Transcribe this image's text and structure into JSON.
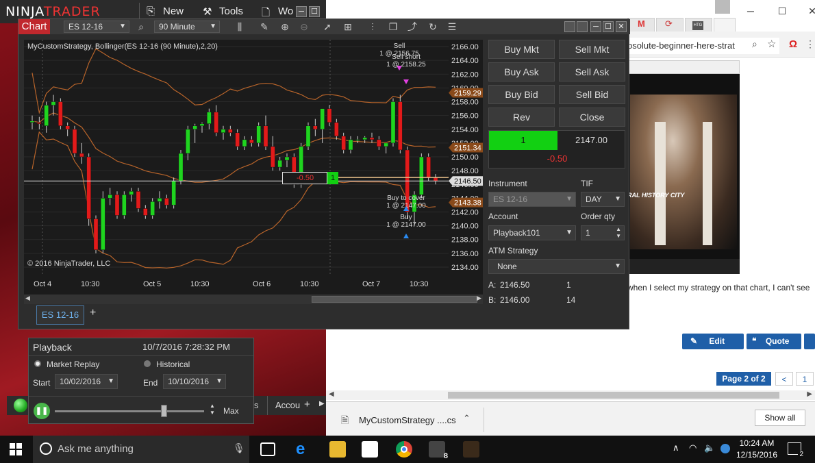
{
  "ninjatrader": {
    "logo_left": "NINJA",
    "logo_right": "TRADER",
    "menu": {
      "new": "New",
      "tools": "Tools",
      "workspaces": "Wo"
    }
  },
  "chart": {
    "tab_label": "Chart",
    "instrument": "ES 12-16",
    "interval": "90 Minute",
    "strategy_label": "MyCustomStrategy, Bollinger(ES 12-16 (90 Minute),2,20)",
    "copyright": "© 2016 NinjaTrader, LLC",
    "bottom_tab": "ES 12-16",
    "bottom_tab_add": "+",
    "position_line": {
      "pnl": "-0.50",
      "qty": "1"
    }
  },
  "chart_data": {
    "type": "candlestick",
    "title": "",
    "x_tick_labels": [
      "Oct 4",
      "10:30",
      "Oct 5",
      "10:30",
      "Oct 6",
      "10:30",
      "Oct 7",
      "10:30"
    ],
    "y_tick_labels": [
      "2166.00",
      "2164.00",
      "2162.00",
      "2160.00",
      "2158.00",
      "2156.00",
      "2154.00",
      "2152.00",
      "2150.00",
      "2148.00",
      "2146.00",
      "2144.00",
      "2142.00",
      "2140.00",
      "2138.00",
      "2136.00",
      "2134.00"
    ],
    "ylim": [
      2133,
      2167
    ],
    "price_markers": [
      {
        "value": "2159.29",
        "color": "#8a4a1a"
      },
      {
        "value": "2151.34",
        "color": "#8a4a1a"
      },
      {
        "value": "2146.50",
        "color": "#dddddd"
      },
      {
        "value": "2143.38",
        "color": "#8a4a1a"
      }
    ],
    "candles": [
      [
        2155.0,
        2156.0,
        2154.0,
        2155.2
      ],
      [
        2155.0,
        2155.8,
        2154.0,
        2154.8
      ],
      [
        2154.5,
        2158.0,
        2153.5,
        2157.5
      ],
      [
        2157.5,
        2159.0,
        2156.0,
        2158.0
      ],
      [
        2158.0,
        2158.5,
        2154.0,
        2154.5
      ],
      [
        2154.5,
        2155.0,
        2153.0,
        2154.0
      ],
      [
        2154.0,
        2154.5,
        2150.0,
        2150.5
      ],
      [
        2150.5,
        2152.0,
        2149.0,
        2150.0
      ],
      [
        2150.0,
        2150.5,
        2140.0,
        2141.0
      ],
      [
        2141.0,
        2141.5,
        2136.0,
        2136.5
      ],
      [
        2136.5,
        2145.0,
        2136.0,
        2144.0
      ],
      [
        2144.0,
        2145.5,
        2143.0,
        2144.5
      ],
      [
        2144.5,
        2145.0,
        2141.0,
        2141.5
      ],
      [
        2141.5,
        2145.0,
        2141.0,
        2144.5
      ],
      [
        2144.5,
        2145.5,
        2143.5,
        2145.0
      ],
      [
        2145.0,
        2145.5,
        2142.0,
        2142.5
      ],
      [
        2142.5,
        2143.0,
        2141.0,
        2141.5
      ],
      [
        2141.5,
        2144.0,
        2141.0,
        2143.5
      ],
      [
        2143.5,
        2145.0,
        2142.5,
        2144.0
      ],
      [
        2144.0,
        2144.5,
        2142.5,
        2143.0
      ],
      [
        2143.0,
        2147.0,
        2142.5,
        2146.5
      ],
      [
        2146.5,
        2151.0,
        2146.0,
        2150.5
      ],
      [
        2150.5,
        2154.5,
        2149.5,
        2154.0
      ],
      [
        2154.0,
        2154.8,
        2152.0,
        2154.5
      ],
      [
        2154.5,
        2155.0,
        2153.5,
        2154.8
      ],
      [
        2154.8,
        2157.0,
        2154.0,
        2156.5
      ],
      [
        2156.5,
        2157.5,
        2153.0,
        2153.5
      ],
      [
        2153.5,
        2154.5,
        2152.5,
        2154.0
      ],
      [
        2154.0,
        2154.5,
        2153.0,
        2153.5
      ],
      [
        2153.5,
        2154.0,
        2151.0,
        2151.5
      ],
      [
        2151.5,
        2153.0,
        2151.0,
        2152.5
      ],
      [
        2152.5,
        2153.0,
        2151.5,
        2152.0
      ],
      [
        2152.0,
        2155.0,
        2151.5,
        2154.5
      ],
      [
        2154.5,
        2156.0,
        2151.0,
        2151.5
      ],
      [
        2151.5,
        2153.0,
        2148.0,
        2148.5
      ],
      [
        2148.5,
        2150.0,
        2148.0,
        2149.5
      ],
      [
        2149.5,
        2150.5,
        2148.5,
        2150.0
      ],
      [
        2150.0,
        2150.5,
        2145.5,
        2146.0
      ],
      [
        2146.0,
        2152.0,
        2145.5,
        2151.5
      ],
      [
        2151.5,
        2155.0,
        2151.0,
        2154.5
      ],
      [
        2154.5,
        2155.5,
        2153.0,
        2154.0
      ],
      [
        2154.0,
        2155.0,
        2152.0,
        2157.0
      ],
      [
        2157.0,
        2157.5,
        2154.5,
        2155.0
      ],
      [
        2155.0,
        2155.5,
        2152.5,
        2153.0
      ],
      [
        2153.0,
        2153.5,
        2150.5,
        2151.0
      ],
      [
        2151.0,
        2153.0,
        2150.5,
        2152.5
      ],
      [
        2152.5,
        2153.0,
        2152.0,
        2152.5
      ],
      [
        2152.5,
        2153.0,
        2152.0,
        2152.8
      ],
      [
        2152.8,
        2153.5,
        2152.0,
        2152.5
      ],
      [
        2152.5,
        2153.0,
        2151.0,
        2151.5
      ],
      [
        2151.5,
        2152.0,
        2150.5,
        2152.0
      ],
      [
        2152.0,
        2158.5,
        2151.5,
        2158.0
      ],
      [
        2158.0,
        2159.0,
        2150.5,
        2151.0
      ],
      [
        2151.0,
        2151.5,
        2141.0,
        2142.0
      ],
      [
        2142.0,
        2145.0,
        2140.0,
        2144.5
      ],
      [
        2144.5,
        2150.5,
        2144.0,
        2150.0
      ],
      [
        2150.0,
        2150.5,
        2146.5,
        2147.0
      ],
      [
        2147.0,
        2147.5,
        2146.0,
        2146.5
      ]
    ],
    "markers": [
      {
        "label": "Sell",
        "sub": "1 @ 2156.75",
        "color": "#e040e0"
      },
      {
        "label": "Sell short",
        "sub": "1 @ 2158.25",
        "color": "#e040e0"
      },
      {
        "label": "Buy to cover",
        "sub": "1 @ 2147.00",
        "color": "#2a8af0"
      },
      {
        "label": "Buy",
        "sub": "1 @ 2147.00",
        "color": "#2a8af0"
      }
    ]
  },
  "trader": {
    "buttons": [
      "Buy Mkt",
      "Sell Mkt",
      "Buy Ask",
      "Sell Ask",
      "Buy Bid",
      "Sell Bid",
      "Rev",
      "Close"
    ],
    "position_qty": "1",
    "position_price": "2147.00",
    "position_pnl": "-0.50",
    "instrument_label": "Instrument",
    "instrument_value": "ES 12-16",
    "tif_label": "TIF",
    "tif_value": "DAY",
    "account_label": "Account",
    "account_value": "Playback101",
    "order_qty_label": "Order qty",
    "order_qty_value": "1",
    "atm_label": "ATM Strategy",
    "atm_value": "None",
    "ask_label": "A:",
    "ask_price": "2146.50",
    "ask_size": "1",
    "bid_label": "B:",
    "bid_price": "2146.00",
    "bid_size": "14",
    "accent_buy": "#12d012",
    "accent_loss": "#e33333"
  },
  "playback": {
    "title": "Playback",
    "datetime": "10/7/2016 7:28:32 PM",
    "market_replay": "Market Replay",
    "historical": "Historical",
    "start_label": "Start",
    "start_value": "10/02/2016",
    "end_label": "End",
    "end_value": "10/10/2016",
    "speed_label": "Max"
  },
  "control_center": {
    "tab_partial": "s",
    "accounts_tab": "Accou",
    "add": "+"
  },
  "browser": {
    "url_fragment": "bsolute-beginner-here-strat",
    "video_caption": "RAL HISTORY\nCITY",
    "forum_text": "when I select my strategy on that chart, I can't see",
    "edit_button": "Edit",
    "quote_button": "Quote",
    "pager_label": "Page 2 of 2",
    "pager_prev": "<",
    "pager_page": "1",
    "download_file": "MyCustomStrategy ....cs",
    "show_all": "Show all"
  },
  "taskbar": {
    "search_placeholder": "Ask me anything",
    "time": "10:24 AM",
    "date": "12/15/2016",
    "notif_count": "2",
    "nt_badge": "8"
  }
}
